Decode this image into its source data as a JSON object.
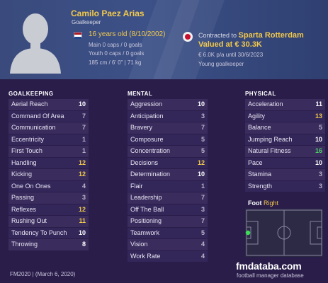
{
  "player": {
    "name": "Camilo Paez Arias",
    "position": "Goalkeeper",
    "age_line": "16 years old (8/10/2002)",
    "main_caps": "Main 0 caps / 0 goals",
    "youth_caps": "Youth 0 caps / 0 goals",
    "physique": "185 cm / 6' 0\" | 71 kg",
    "contract_prefix": "Contracted to ",
    "club": "Sparta Rotterdam",
    "value": "Valued at € 30.3K",
    "wage": "€ 6.0K p/a until 30/6/2023",
    "role": "Young goalkeeper"
  },
  "colors": {
    "accent_yellow": "#f2c94c",
    "accent_green": "#4fd16b",
    "value_white": "#ffffff",
    "value_gray": "#b8b4c9"
  },
  "sections": {
    "goalkeeping": "GOALKEEPING",
    "mental": "MENTAL",
    "physical": "PHYSICAL"
  },
  "goalkeeping": [
    {
      "label": "Aerial Reach",
      "value": "10",
      "tier": "white"
    },
    {
      "label": "Command Of Area",
      "value": "7",
      "tier": "gray"
    },
    {
      "label": "Communication",
      "value": "7",
      "tier": "gray"
    },
    {
      "label": "Eccentricity",
      "value": "1",
      "tier": "gray"
    },
    {
      "label": "First Touch",
      "value": "1",
      "tier": "gray"
    },
    {
      "label": "Handling",
      "value": "12",
      "tier": "yellow"
    },
    {
      "label": "Kicking",
      "value": "12",
      "tier": "yellow"
    },
    {
      "label": "One On Ones",
      "value": "4",
      "tier": "gray"
    },
    {
      "label": "Passing",
      "value": "3",
      "tier": "gray"
    },
    {
      "label": "Reflexes",
      "value": "12",
      "tier": "yellow"
    },
    {
      "label": "Rushing Out",
      "value": "11",
      "tier": "yellow"
    },
    {
      "label": "Tendency To Punch",
      "value": "10",
      "tier": "white"
    },
    {
      "label": "Throwing",
      "value": "8",
      "tier": "white"
    }
  ],
  "mental": [
    {
      "label": "Aggression",
      "value": "10",
      "tier": "white"
    },
    {
      "label": "Anticipation",
      "value": "3",
      "tier": "gray"
    },
    {
      "label": "Bravery",
      "value": "7",
      "tier": "gray"
    },
    {
      "label": "Composure",
      "value": "5",
      "tier": "gray"
    },
    {
      "label": "Concentration",
      "value": "5",
      "tier": "gray"
    },
    {
      "label": "Decisions",
      "value": "12",
      "tier": "yellow"
    },
    {
      "label": "Determination",
      "value": "10",
      "tier": "white"
    },
    {
      "label": "Flair",
      "value": "1",
      "tier": "gray"
    },
    {
      "label": "Leadership",
      "value": "7",
      "tier": "gray"
    },
    {
      "label": "Off The Ball",
      "value": "3",
      "tier": "gray"
    },
    {
      "label": "Positioning",
      "value": "7",
      "tier": "gray"
    },
    {
      "label": "Teamwork",
      "value": "5",
      "tier": "gray"
    },
    {
      "label": "Vision",
      "value": "4",
      "tier": "gray"
    },
    {
      "label": "Work Rate",
      "value": "4",
      "tier": "gray"
    }
  ],
  "physical": [
    {
      "label": "Acceleration",
      "value": "11",
      "tier": "white"
    },
    {
      "label": "Agility",
      "value": "13",
      "tier": "yellow"
    },
    {
      "label": "Balance",
      "value": "5",
      "tier": "gray"
    },
    {
      "label": "Jumping Reach",
      "value": "10",
      "tier": "white"
    },
    {
      "label": "Natural Fitness",
      "value": "16",
      "tier": "green"
    },
    {
      "label": "Pace",
      "value": "10",
      "tier": "white"
    },
    {
      "label": "Stamina",
      "value": "3",
      "tier": "gray"
    },
    {
      "label": "Strength",
      "value": "3",
      "tier": "gray"
    }
  ],
  "foot": {
    "label": "Foot",
    "value": "Right"
  },
  "footer": {
    "version": "FM2020 | (March 6, 2020)",
    "brand": "fmdataba.com",
    "brand_sub": "football manager database"
  }
}
